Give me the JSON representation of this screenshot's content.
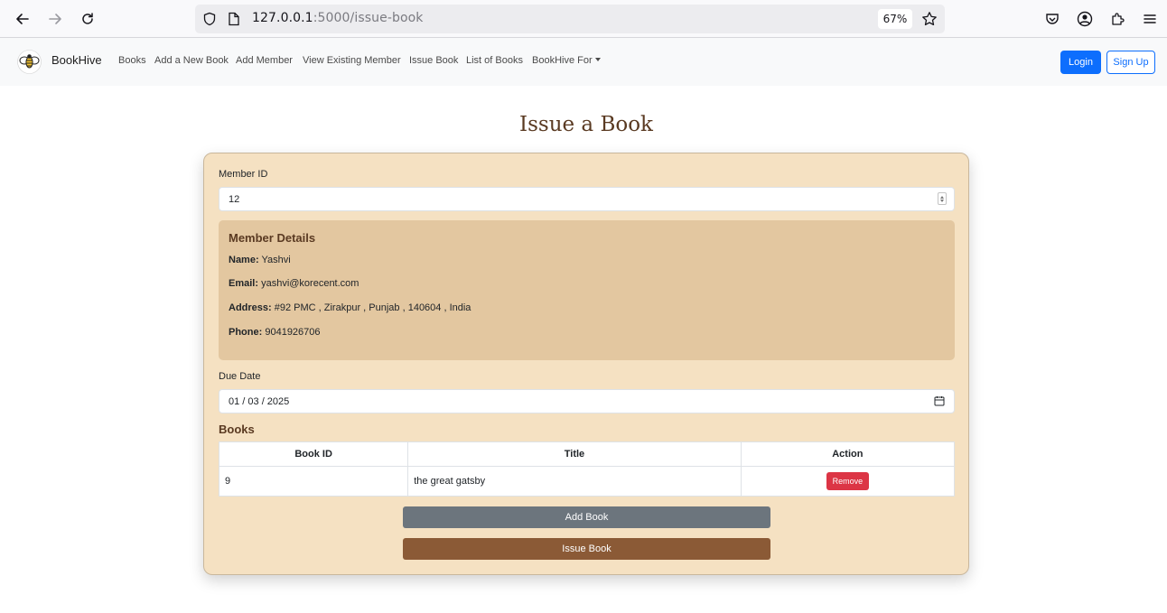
{
  "browser": {
    "url_host": "127.0.0.1",
    "url_path": ":5000/issue-book",
    "zoom": "67%"
  },
  "navbar": {
    "brand": "BookHive",
    "links": [
      "Books",
      "Add a New Book",
      "Add Member",
      "View Existing Member",
      "Issue Book",
      "List of Books",
      "BookHive For"
    ],
    "login": "Login",
    "signup": "Sign Up"
  },
  "page": {
    "title": "Issue a Book"
  },
  "form": {
    "member_id_label": "Member ID",
    "member_id_value": "12",
    "member_details": {
      "heading": "Member Details",
      "name_label": "Name:",
      "name": "Yashvi",
      "email_label": "Email:",
      "email": "yashvi@korecent.com",
      "address_label": "Address:",
      "address": "#92 PMC , Zirakpur , Punjab , 140604 , India",
      "phone_label": "Phone:",
      "phone": "9041926706"
    },
    "due_date_label": "Due Date",
    "due_date_value": "01 / 03 / 2025",
    "books_heading": "Books",
    "table": {
      "headers": [
        "Book ID",
        "Title",
        "Action"
      ],
      "rows": [
        {
          "book_id": "9",
          "title": "the great gatsby",
          "action": "Remove"
        }
      ]
    },
    "add_book": "Add Book",
    "issue_book": "Issue Book"
  },
  "colors": {
    "card_bg": "#f5e1c2",
    "member_box_bg": "#e3c7a0",
    "primary": "#0d6efd",
    "danger": "#dc3545",
    "secondary": "#6c757d",
    "brown": "#8b5a36"
  }
}
